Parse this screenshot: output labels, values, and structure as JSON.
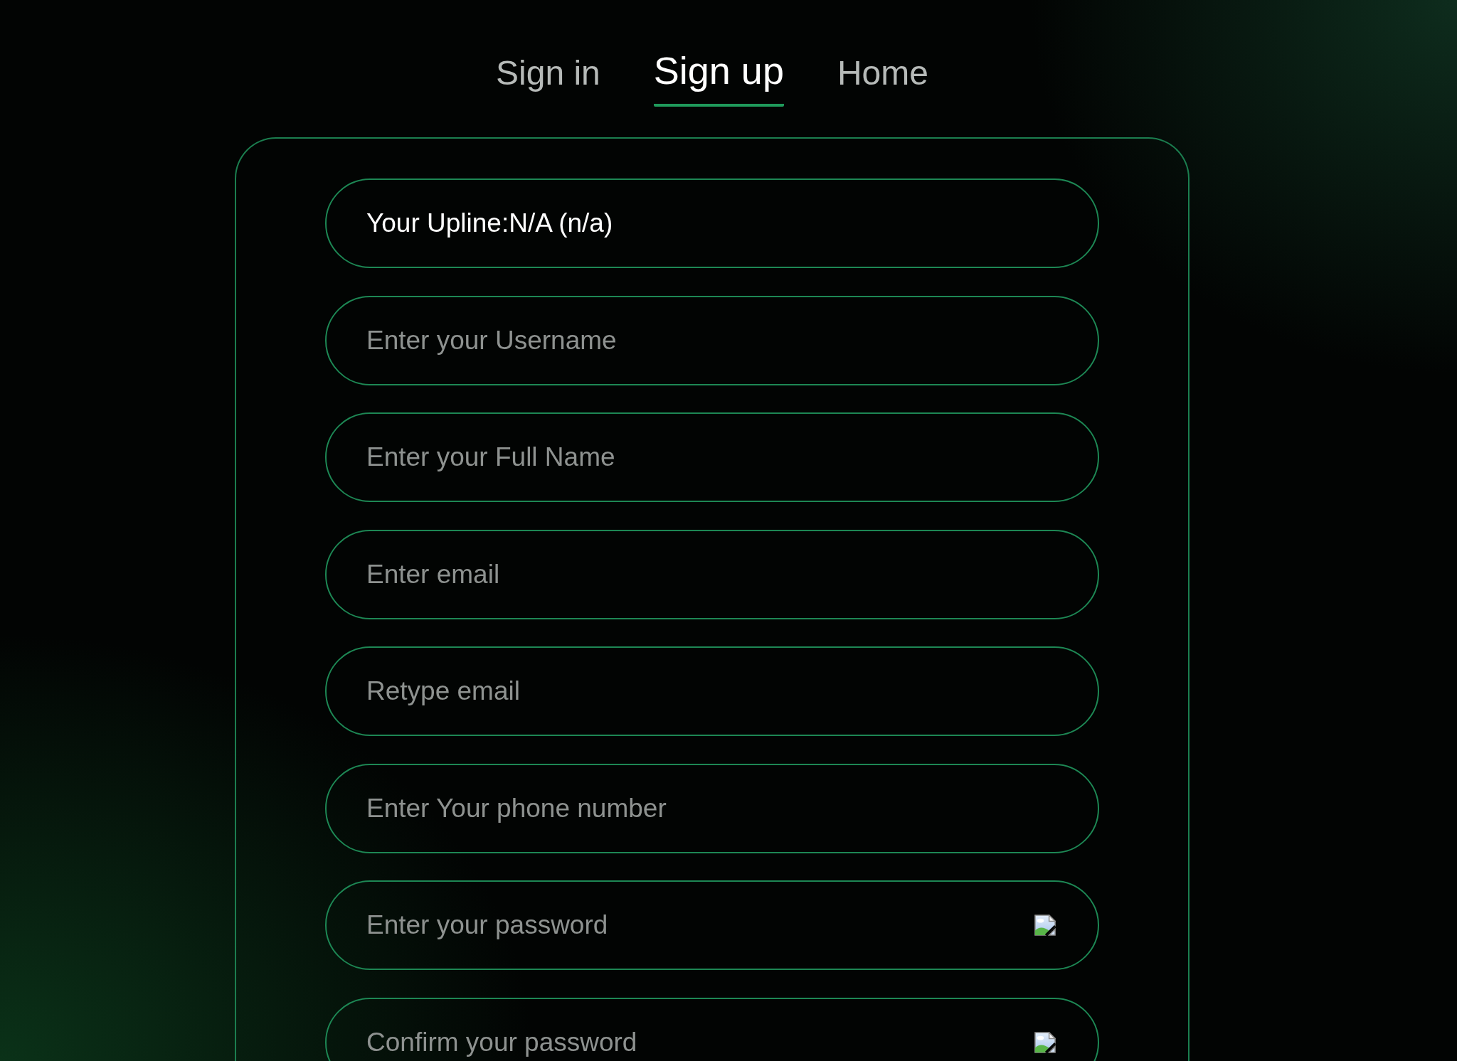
{
  "tabs": [
    {
      "label": "Sign in",
      "selected": false
    },
    {
      "label": "Sign up",
      "selected": true
    },
    {
      "label": "Home",
      "selected": false
    }
  ],
  "form": {
    "fields": [
      {
        "kind": "info",
        "value": "Your Upline:N/A (n/a)"
      },
      {
        "kind": "text",
        "placeholder": "Enter your Username"
      },
      {
        "kind": "text",
        "placeholder": "Enter your Full Name"
      },
      {
        "kind": "text",
        "placeholder": "Enter email"
      },
      {
        "kind": "text",
        "placeholder": "Retype email"
      },
      {
        "kind": "text",
        "placeholder": "Enter Your phone number"
      },
      {
        "kind": "password",
        "placeholder": "Enter your password"
      },
      {
        "kind": "password",
        "placeholder": "Confirm your password"
      }
    ]
  }
}
